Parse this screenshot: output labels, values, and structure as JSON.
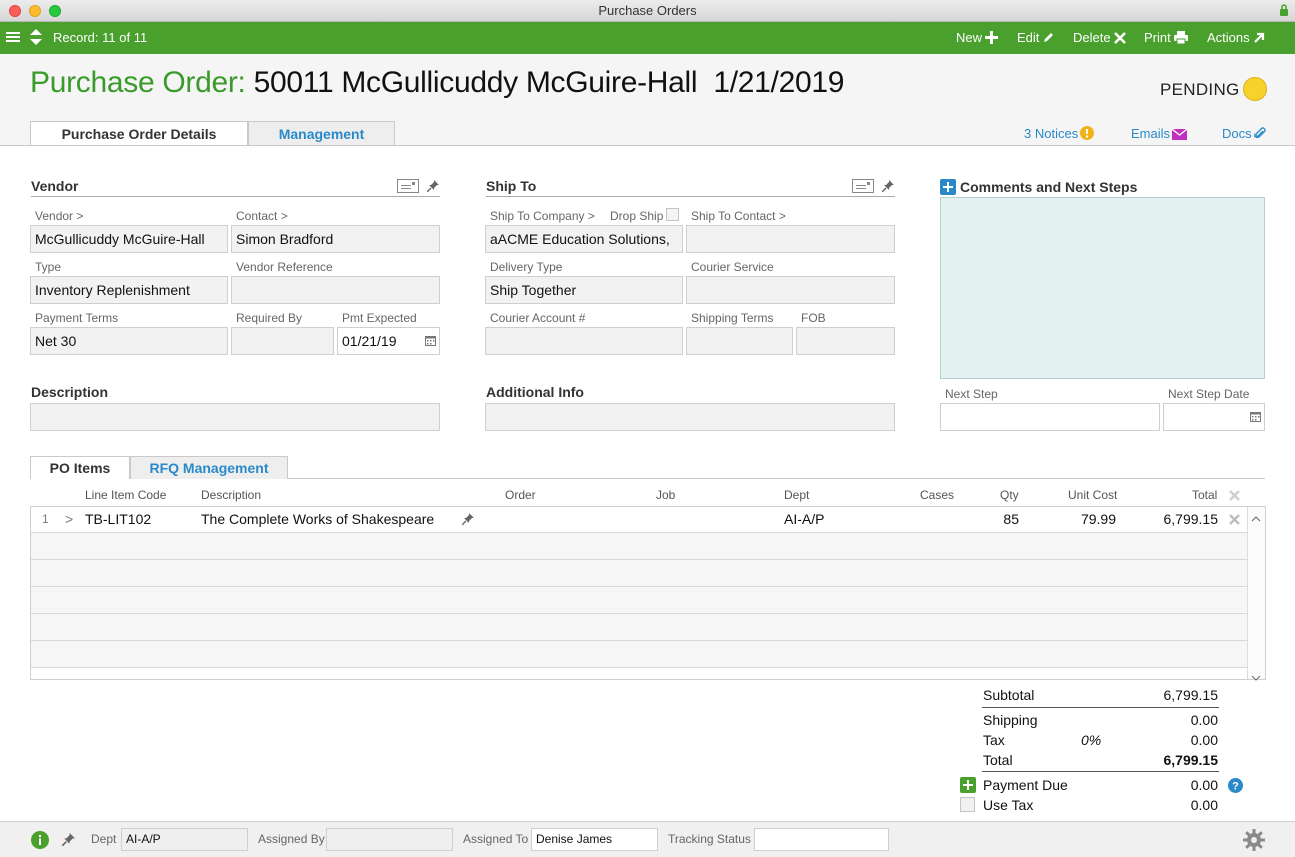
{
  "window": {
    "title": "Purchase Orders"
  },
  "toolbar": {
    "record": "Record: 11 of 11",
    "new": "New",
    "edit": "Edit",
    "delete": "Delete",
    "print": "Print",
    "actions": "Actions"
  },
  "header": {
    "label": "Purchase Order:",
    "value": "50011 McGullicuddy McGuire-Hall  1/21/2019",
    "status": "PENDING",
    "status_color": "#f7d22a"
  },
  "tabs": [
    {
      "label": "Purchase Order Details"
    },
    {
      "label": "Management"
    }
  ],
  "links": {
    "notices": "3 Notices",
    "emails": "Emails",
    "docs": "Docs"
  },
  "vendor": {
    "section": "Vendor",
    "vendor_label": "Vendor >",
    "vendor_value": "McGullicuddy McGuire-Hall",
    "contact_label": "Contact >",
    "contact_value": "Simon Bradford",
    "type_label": "Type",
    "type_value": "Inventory Replenishment",
    "vendor_ref_label": "Vendor Reference",
    "vendor_ref_value": "",
    "payment_terms_label": "Payment Terms",
    "payment_terms_value": "Net 30",
    "required_by_label": "Required By",
    "required_by_value": "",
    "pmt_expected_label": "Pmt Expected",
    "pmt_expected_value": "01/21/19"
  },
  "ship_to": {
    "section": "Ship To",
    "company_label": "Ship To Company >",
    "drop_ship_label": "Drop Ship",
    "company_value": "aACME Education Solutions,",
    "contact_label": "Ship To Contact >",
    "contact_value": "",
    "delivery_type_label": "Delivery Type",
    "delivery_type_value": "Ship Together",
    "courier_service_label": "Courier Service",
    "courier_service_value": "",
    "courier_account_label": "Courier Account #",
    "shipping_terms_label": "Shipping Terms",
    "fob_label": "FOB"
  },
  "comments": {
    "section": "Comments and Next Steps",
    "next_step_label": "Next Step",
    "next_step_date_label": "Next Step Date"
  },
  "description": {
    "section": "Description"
  },
  "additional_info": {
    "section": "Additional Info"
  },
  "item_tabs": [
    {
      "label": "PO Items"
    },
    {
      "label": "RFQ Management"
    }
  ],
  "items_table": {
    "columns": [
      "Line Item Code",
      "Description",
      "Order",
      "Job",
      "Dept",
      "Cases",
      "Qty",
      "Unit Cost",
      "Total"
    ],
    "rows": [
      {
        "num": "1",
        "code": "TB-LIT102",
        "description": "The Complete Works of Shakespeare",
        "order": "",
        "job": "",
        "dept": "AI-A/P",
        "cases": "",
        "qty": "85",
        "unit_cost": "79.99",
        "total": "6,799.15"
      }
    ]
  },
  "totals": {
    "subtotal_label": "Subtotal",
    "subtotal": "6,799.15",
    "shipping_label": "Shipping",
    "shipping": "0.00",
    "tax_label": "Tax",
    "tax_rate": "0%",
    "tax": "0.00",
    "total_label": "Total",
    "total": "6,799.15",
    "payment_due_label": "Payment Due",
    "payment_due": "0.00",
    "use_tax_label": "Use Tax",
    "use_tax": "0.00"
  },
  "footer": {
    "dept_label": "Dept",
    "dept_value": "AI-A/P",
    "assigned_by_label": "Assigned By",
    "assigned_by_value": "",
    "assigned_to_label": "Assigned To",
    "assigned_to_value": "Denise James",
    "tracking_status_label": "Tracking Status",
    "tracking_status_value": ""
  },
  "colors": {
    "accent_green": "#4aa02c",
    "title_green": "#3a9a2b",
    "link_blue": "#2a8ac9",
    "notes_bg": "#e3f2f1"
  }
}
